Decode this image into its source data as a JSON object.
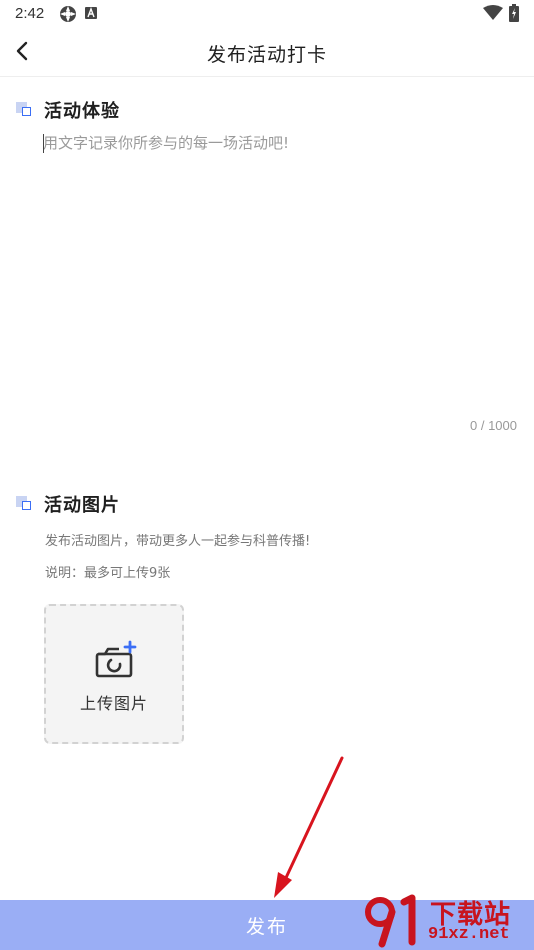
{
  "status_bar": {
    "time": "2:42",
    "icons": [
      "settings-status-icon",
      "app-a-status-icon",
      "wifi-icon",
      "battery-icon"
    ]
  },
  "header": {
    "title": "发布活动打卡",
    "back_icon": "chevron-left-icon"
  },
  "experience": {
    "title": "活动体验",
    "placeholder": "用文字记录你所参与的每一场活动吧!",
    "value": "",
    "count": "0 / 1000"
  },
  "photos": {
    "title": "活动图片",
    "desc": "发布活动图片，带动更多人一起参与科普传播!",
    "note": "说明：最多可上传9张",
    "upload_label": "上传图片",
    "upload_icon": "camera-add-icon"
  },
  "publish_label": "发布",
  "watermark": {
    "top": "下载站",
    "bottom": "91xz.net"
  },
  "colors": {
    "accent": "#3b6ef5",
    "publish_bg": "#9aaef5",
    "annotation_arrow": "#d8141e",
    "watermark": "#c8141e"
  }
}
